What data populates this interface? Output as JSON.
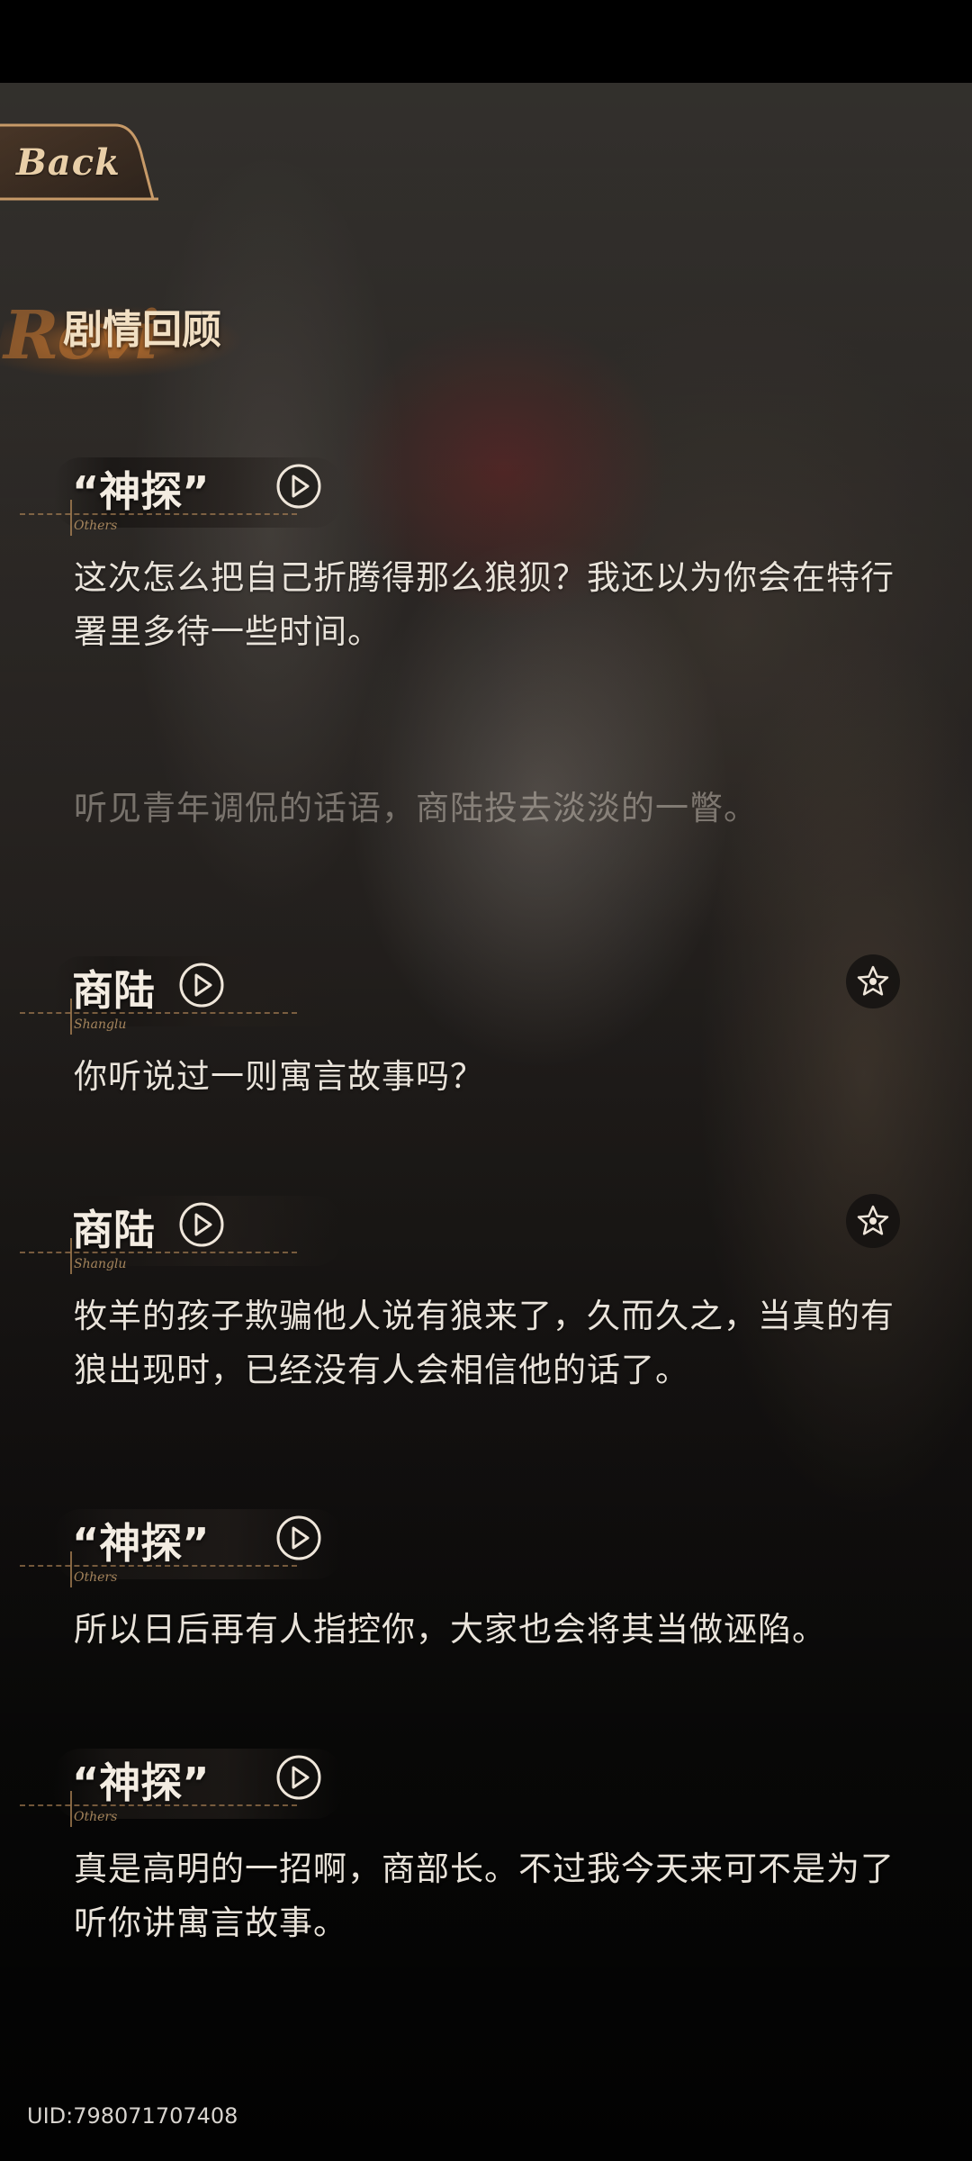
{
  "nav": {
    "back_label": "Back"
  },
  "section": {
    "title": "剧情回顾",
    "script_text": "Revi"
  },
  "entries": [
    {
      "speaker": "“神探”",
      "speaker_sub": "Others",
      "text": "这次怎么把自己折腾得那么狼狈？我还以为你会在特行署里多待一些时间。",
      "favorite": false
    },
    {
      "speaker": "商陆",
      "speaker_sub": "Shanglu",
      "text": "你听说过一则寓言故事吗？",
      "favorite": true
    },
    {
      "speaker": "商陆",
      "speaker_sub": "Shanglu",
      "text": "牧羊的孩子欺骗他人说有狼来了，久而久之，当真的有狼出现时，已经没有人会相信他的话了。",
      "favorite": true
    },
    {
      "speaker": "“神探”",
      "speaker_sub": "Others",
      "text": "所以日后再有人指控你，大家也会将其当做诬陷。",
      "favorite": false
    },
    {
      "speaker": "“神探”",
      "speaker_sub": "Others",
      "text": "真是高明的一招啊，商部长。不过我今天来可不是为了听你讲寓言故事。",
      "favorite": false
    }
  ],
  "narration": {
    "text": "听见青年调侃的话语，商陆投去淡淡的一瞥。"
  },
  "footer": {
    "uid": "UID:798071707408"
  },
  "icons": {
    "play": "play-circle-icon",
    "favorite": "star-icon"
  },
  "colors": {
    "accent_gold": "#e9cfa8",
    "text_primary": "#e9e3da",
    "brush_orange": "#b0682a"
  }
}
